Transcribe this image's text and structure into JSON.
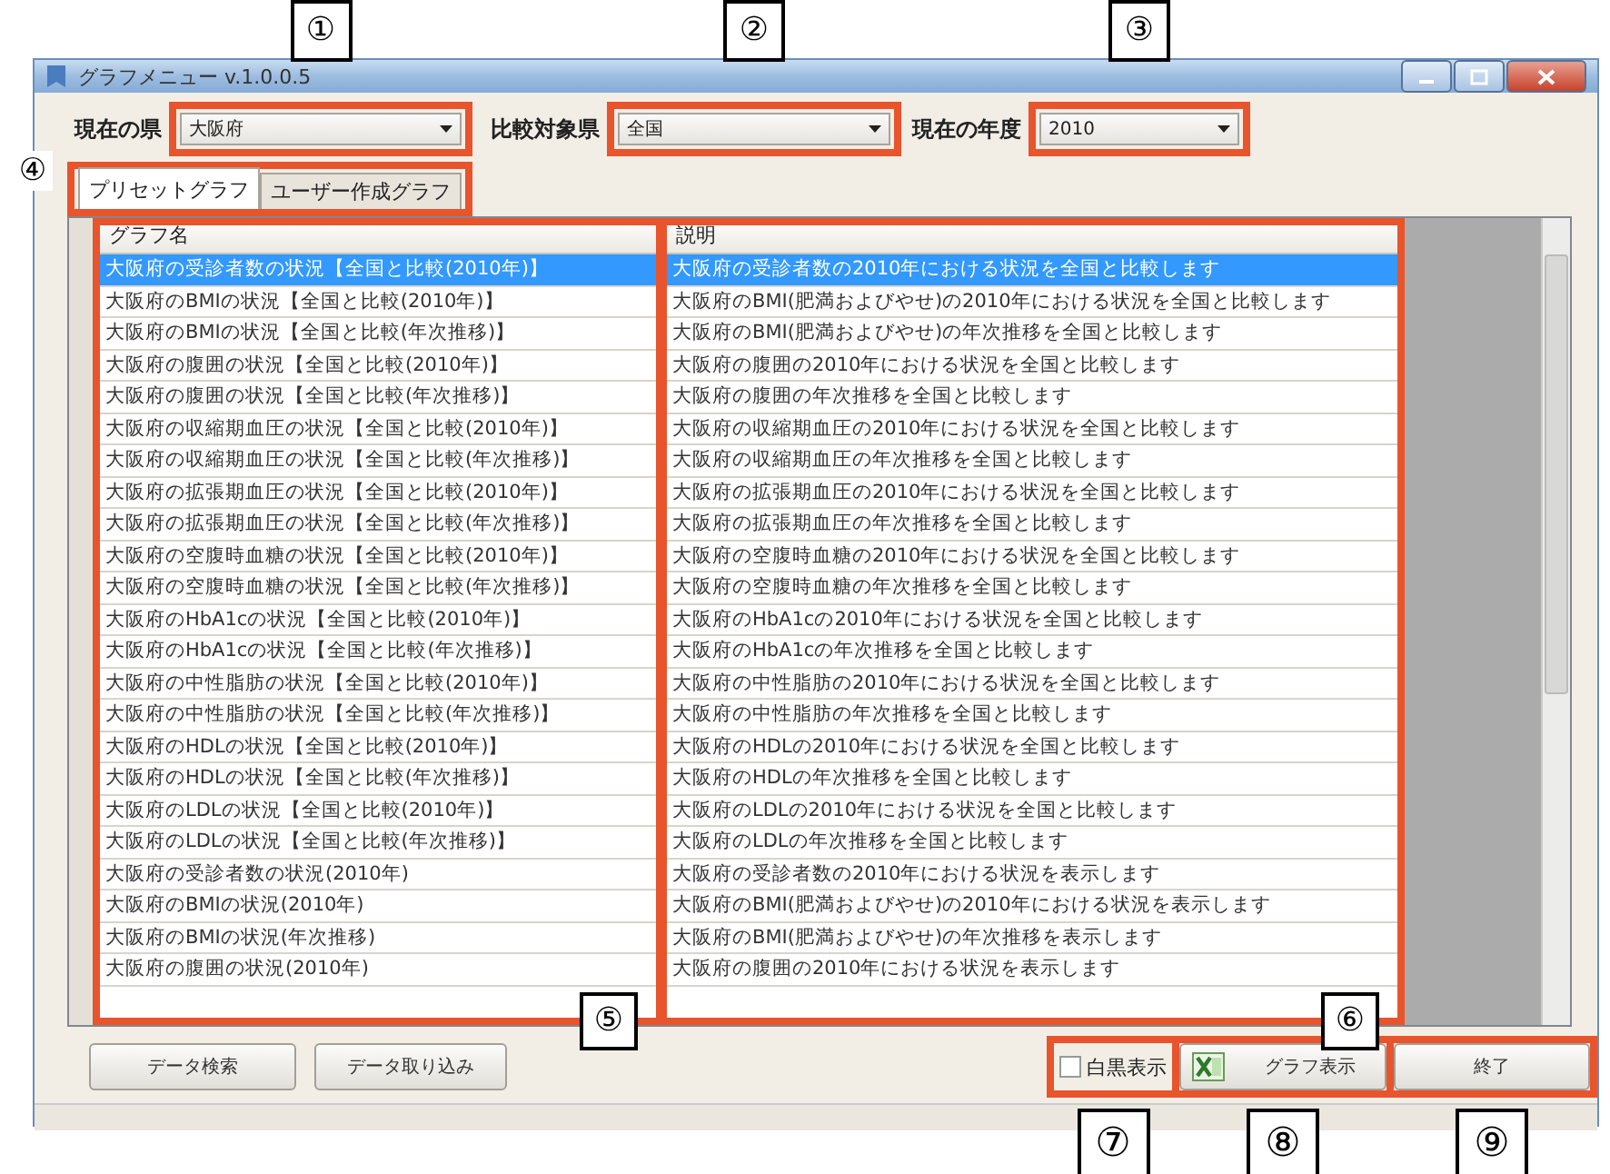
{
  "window": {
    "title": "グラフメニュー v.1.0.0.5"
  },
  "filters": [
    {
      "label": "現在の県",
      "value": "大阪府",
      "callout": "①"
    },
    {
      "label": "比較対象県",
      "value": "全国",
      "callout": "②"
    },
    {
      "label": "現在の年度",
      "value": "2010",
      "callout": "③"
    }
  ],
  "tabs": {
    "callout": "④",
    "items": [
      {
        "label": "プリセットグラフ",
        "selected": true
      },
      {
        "label": "ユーザー作成グラフ",
        "selected": false
      }
    ]
  },
  "table": {
    "callouts": [
      "⑤",
      "⑥"
    ],
    "columns": [
      {
        "header": "グラフ名"
      },
      {
        "header": "説明"
      }
    ],
    "rows": [
      {
        "cells": [
          "大阪府の受診者数の状況【全国と比較(2010年)】",
          "大阪府の受診者数の2010年における状況を全国と比較します"
        ],
        "selected": true
      },
      {
        "cells": [
          "大阪府のBMIの状況【全国と比較(2010年)】",
          "大阪府のBMI(肥満およびやせ)の2010年における状況を全国と比較します"
        ],
        "selected": false
      },
      {
        "cells": [
          "大阪府のBMIの状況【全国と比較(年次推移)】",
          "大阪府のBMI(肥満およびやせ)の年次推移を全国と比較します"
        ],
        "selected": false
      },
      {
        "cells": [
          "大阪府の腹囲の状況【全国と比較(2010年)】",
          "大阪府の腹囲の2010年における状況を全国と比較します"
        ],
        "selected": false
      },
      {
        "cells": [
          "大阪府の腹囲の状況【全国と比較(年次推移)】",
          "大阪府の腹囲の年次推移を全国と比較します"
        ],
        "selected": false
      },
      {
        "cells": [
          "大阪府の収縮期血圧の状況【全国と比較(2010年)】",
          "大阪府の収縮期血圧の2010年における状況を全国と比較します"
        ],
        "selected": false
      },
      {
        "cells": [
          "大阪府の収縮期血圧の状況【全国と比較(年次推移)】",
          "大阪府の収縮期血圧の年次推移を全国と比較します"
        ],
        "selected": false
      },
      {
        "cells": [
          "大阪府の拡張期血圧の状況【全国と比較(2010年)】",
          "大阪府の拡張期血圧の2010年における状況を全国と比較します"
        ],
        "selected": false
      },
      {
        "cells": [
          "大阪府の拡張期血圧の状況【全国と比較(年次推移)】",
          "大阪府の拡張期血圧の年次推移を全国と比較します"
        ],
        "selected": false
      },
      {
        "cells": [
          "大阪府の空腹時血糖の状況【全国と比較(2010年)】",
          "大阪府の空腹時血糖の2010年における状況を全国と比較します"
        ],
        "selected": false
      },
      {
        "cells": [
          "大阪府の空腹時血糖の状況【全国と比較(年次推移)】",
          "大阪府の空腹時血糖の年次推移を全国と比較します"
        ],
        "selected": false
      },
      {
        "cells": [
          "大阪府のHbA1cの状況【全国と比較(2010年)】",
          "大阪府のHbA1cの2010年における状況を全国と比較します"
        ],
        "selected": false
      },
      {
        "cells": [
          "大阪府のHbA1cの状況【全国と比較(年次推移)】",
          "大阪府のHbA1cの年次推移を全国と比較します"
        ],
        "selected": false
      },
      {
        "cells": [
          "大阪府の中性脂肪の状況【全国と比較(2010年)】",
          "大阪府の中性脂肪の2010年における状況を全国と比較します"
        ],
        "selected": false
      },
      {
        "cells": [
          "大阪府の中性脂肪の状況【全国と比較(年次推移)】",
          "大阪府の中性脂肪の年次推移を全国と比較します"
        ],
        "selected": false
      },
      {
        "cells": [
          "大阪府のHDLの状況【全国と比較(2010年)】",
          "大阪府のHDLの2010年における状況を全国と比較します"
        ],
        "selected": false
      },
      {
        "cells": [
          "大阪府のHDLの状況【全国と比較(年次推移)】",
          "大阪府のHDLの年次推移を全国と比較します"
        ],
        "selected": false
      },
      {
        "cells": [
          "大阪府のLDLの状況【全国と比較(2010年)】",
          "大阪府のLDLの2010年における状況を全国と比較します"
        ],
        "selected": false
      },
      {
        "cells": [
          "大阪府のLDLの状況【全国と比較(年次推移)】",
          "大阪府のLDLの年次推移を全国と比較します"
        ],
        "selected": false
      },
      {
        "cells": [
          "大阪府の受診者数の状況(2010年)",
          "大阪府の受診者数の2010年における状況を表示します"
        ],
        "selected": false
      },
      {
        "cells": [
          "大阪府のBMIの状況(2010年)",
          "大阪府のBMI(肥満およびやせ)の2010年における状況を表示します"
        ],
        "selected": false
      },
      {
        "cells": [
          "大阪府のBMIの状況(年次推移)",
          "大阪府のBMI(肥満およびやせ)の年次推移を表示します"
        ],
        "selected": false
      },
      {
        "cells": [
          "大阪府の腹囲の状況(2010年)",
          "大阪府の腹囲の2010年における状況を表示します"
        ],
        "selected": false
      }
    ]
  },
  "data_buttons": [
    {
      "label": "データ検索"
    },
    {
      "label": "データ取り込み"
    }
  ],
  "monochrome": {
    "label": "白黒表示",
    "checked": false,
    "callout": "⑦"
  },
  "graph_button": {
    "label": "グラフ表示",
    "callout": "⑧"
  },
  "exit_button": {
    "label": "終了",
    "callout": "⑨"
  }
}
